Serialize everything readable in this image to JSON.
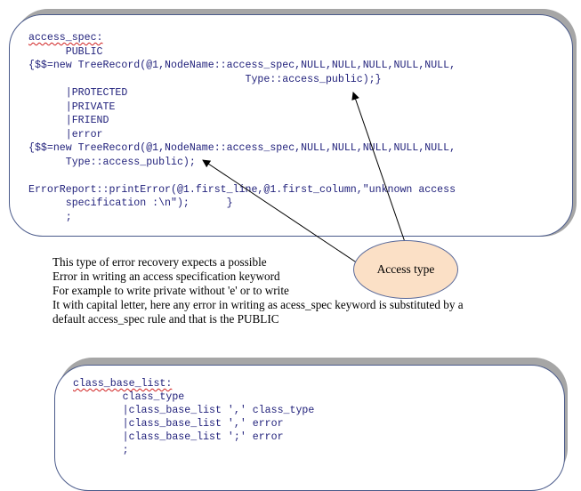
{
  "grammar1": {
    "lines": [
      [
        "access_spec:"
      ],
      [
        "      PUBLIC"
      ],
      [
        "{$$=new TreeRecord(@1,NodeName::access_spec,NULL,NULL,NULL,NULL,NULL,"
      ],
      [
        "                                   Type::access_public);}"
      ],
      [
        "      |PROTECTED"
      ],
      [
        "      |PRIVATE"
      ],
      [
        "      |FRIEND"
      ],
      [
        "      |error"
      ],
      [
        "{$$=new TreeRecord(@1,NodeName::access_spec,NULL,NULL,NULL,NULL,NULL,"
      ],
      [
        "      Type::access_public);"
      ],
      [
        ""
      ],
      [
        "ErrorReport::printError(@1.first_line,@1.first_column,\"unknown access"
      ],
      [
        "      specification :\\n\");      }"
      ],
      [
        "      ;"
      ]
    ]
  },
  "callout": {
    "label": "Access type"
  },
  "description": {
    "lines": [
      "This type of error recovery expects a possible",
      "Error in writing an access specification keyword",
      "For example to write private without 'e' or to write",
      "It with capital letter, here any error in writing as acess_spec keyword is substituted by a",
      "default access_spec rule and that is the PUBLIC"
    ]
  },
  "grammar2": {
    "lines": [
      "class_base_list:",
      "        class_type",
      "        |class_base_list ',' class_type",
      "        |class_base_list ',' error",
      "        |class_base_list ';' error",
      "        ;"
    ]
  },
  "colors": {
    "code_text": "#1f1f7a",
    "squiggle": "#d02020",
    "callout_fill": "#fbe0c6",
    "box_border": "#4a5a8a",
    "shadow": "#a6a6a6"
  }
}
